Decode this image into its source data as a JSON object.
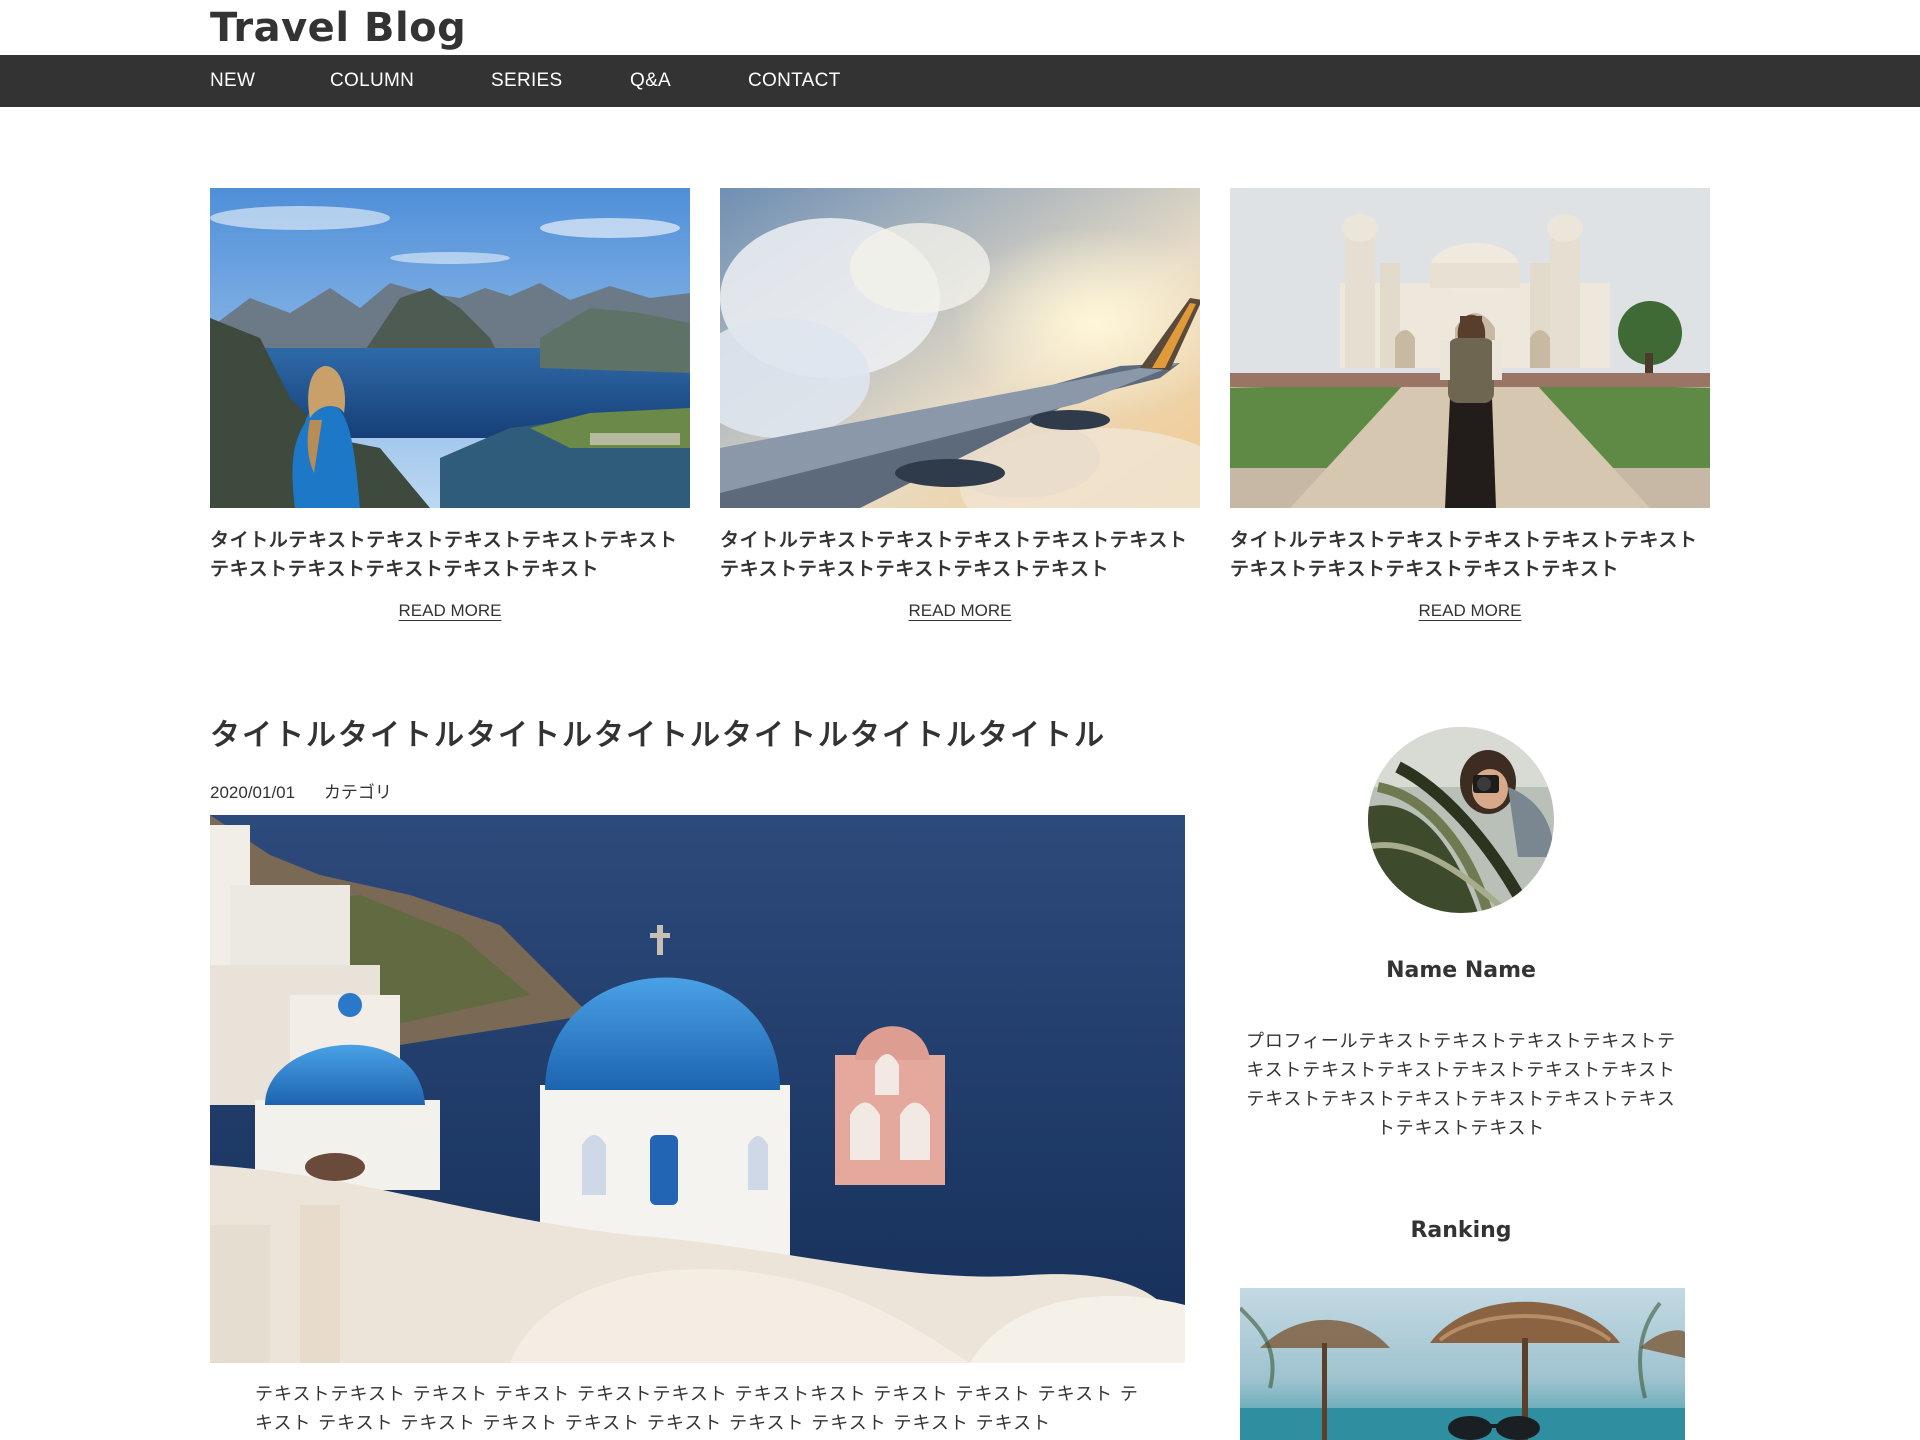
{
  "site": {
    "title": "Travel Blog"
  },
  "nav": {
    "items": [
      {
        "label": "NEW"
      },
      {
        "label": "COLUMN"
      },
      {
        "label": "SERIES"
      },
      {
        "label": "Q&A"
      },
      {
        "label": "CONTACT"
      }
    ]
  },
  "featured": [
    {
      "title": "タイトルテキストテキストテキストテキストテキストテキストテキストテキストテキストテキスト",
      "read_more": "READ MORE",
      "image": "mountain-fjord-photo"
    },
    {
      "title": "タイトルテキストテキストテキストテキストテキストテキストテキストテキストテキストテキスト",
      "read_more": "READ MORE",
      "image": "airplane-wing-photo"
    },
    {
      "title": "タイトルテキストテキストテキストテキストテキストテキストテキストテキストテキストテキスト",
      "read_more": "READ MORE",
      "image": "monument-traveler-photo"
    }
  ],
  "article": {
    "title": "タイトルタイトルタイトルタイトルタイトルタイトルタイトル",
    "date": "2020/01/01",
    "category": "カテゴリ",
    "image": "santorini-domes-photo",
    "body": "テキストテキスト テキスト テキスト テキストテキスト テキストキスト テキスト テキスト テキスト テキスト テキスト テキスト テキスト テキスト テキスト テキスト テキスト テキスト テキスト"
  },
  "sidebar": {
    "profile": {
      "name": "Name Name",
      "text": "プロフィールテキストテキストテキストテキストテキストテキストテキストテキストテキストテキストテキストテキストテキストテキストテキストテキストテキストテキスト",
      "avatar": "photographer-avatar"
    },
    "ranking": {
      "heading": "Ranking",
      "image": "beach-umbrella-photo"
    }
  },
  "colors": {
    "nav_background": "#333333",
    "nav_text": "#ffffff",
    "text": "#333333",
    "background": "#ffffff"
  }
}
